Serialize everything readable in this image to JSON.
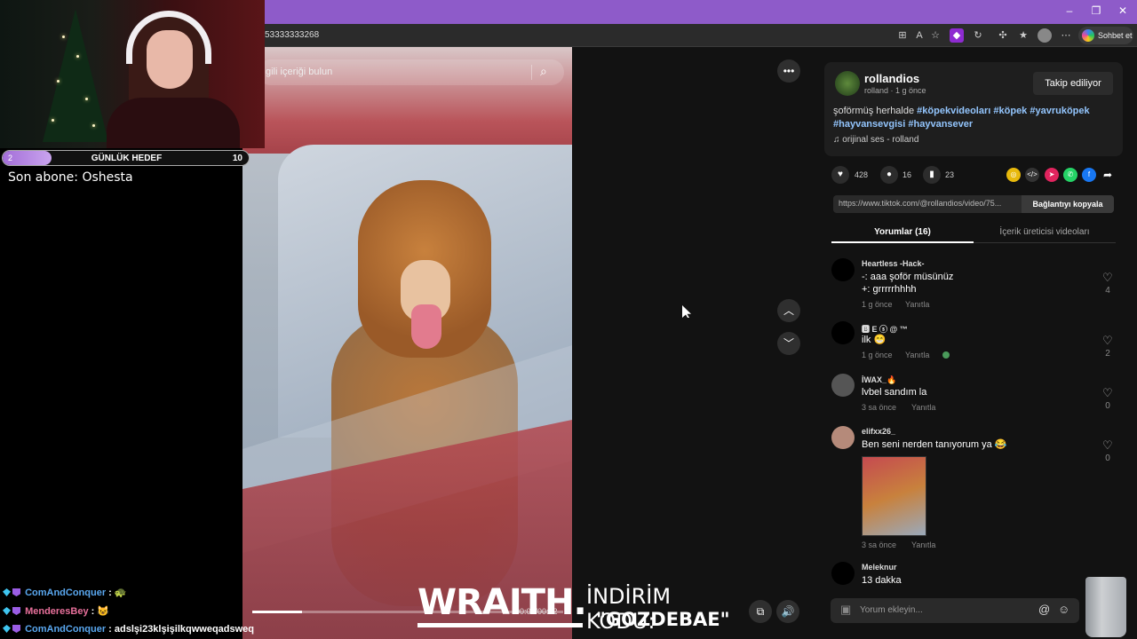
{
  "browser": {
    "url_fragment": "53333333268",
    "sohbet_label": "Sohbet et",
    "win_min": "–",
    "win_max": "❐",
    "win_close": "✕"
  },
  "video": {
    "search_placeholder": "gili içeriği bulun",
    "progress": 0.16,
    "timecode": "00:02/00:12"
  },
  "creator": {
    "username": "rollandios",
    "meta": "rolland · 1 g önce",
    "follow_label": "Takip ediliyor",
    "caption_prefix": "şoförmüş herhalde ",
    "hashtags": [
      "#köpekvideoları",
      "#köpek",
      "#yavruköpek",
      "#hayvansevgisi",
      "#hayvansever"
    ],
    "sound": "orijinal ses - rolland"
  },
  "stats": {
    "likes": "428",
    "comments": "16",
    "saves": "23"
  },
  "link": {
    "url": "https://www.tiktok.com/@rollandios/video/75...",
    "copy_label": "Bağlantıyı kopyala"
  },
  "tabs": {
    "comments": "Yorumlar (16)",
    "creator_videos": "İçerik üreticisi videoları"
  },
  "comments": [
    {
      "name": "Heartless -Hack-",
      "line1": "-: aaa şoför müsünüz",
      "line2": "+: grrrrrhhhh",
      "time": "1 g önce",
      "reply": "Yanıtla",
      "likes": "4"
    },
    {
      "name": "🅱 E ⓢ @ ™",
      "line1": "ilk 😁",
      "line2": "",
      "time": "1 g önce",
      "reply": "Yanıtla",
      "likes": "2"
    },
    {
      "name": "İWAX_🔥",
      "line1": "lvbel sandım la",
      "line2": "",
      "time": "3 sa önce",
      "reply": "Yanıtla",
      "likes": "0"
    },
    {
      "name": "elifxx26_",
      "line1": "Ben seni nerden tanıyorum ya 😂",
      "line2": "",
      "time": "3 sa önce",
      "reply": "Yanıtla",
      "likes": "0"
    },
    {
      "name": "Meleknur",
      "line1": "13 dakka",
      "line2": "",
      "time": "",
      "reply": "",
      "likes": ""
    }
  ],
  "comment_input": {
    "placeholder": "Yorum ekleyin..."
  },
  "stream": {
    "goal_current": "2",
    "goal_title": "GÜNLÜK HEDEF",
    "goal_target": "10",
    "goal_progress": 0.2,
    "last_sub": "Son abone: Oshesta",
    "chat": [
      {
        "user": "ComAndConquer",
        "sep": " : ",
        "msg": "🐢",
        "color": "#5aa8f0"
      },
      {
        "user": "MenderesBey",
        "sep": " : ",
        "msg": "😺",
        "color": "#e8709b"
      },
      {
        "user": "ComAndConquer",
        "sep": " : ",
        "msg": "adslşi23klşişilkqwweqadsweq",
        "color": "#5aa8f0"
      }
    ],
    "sponsor_brand": "WRAITH.",
    "sponsor_line1": "İNDİRİM KODU:",
    "sponsor_line2": "\"GOZDEBAE\""
  }
}
